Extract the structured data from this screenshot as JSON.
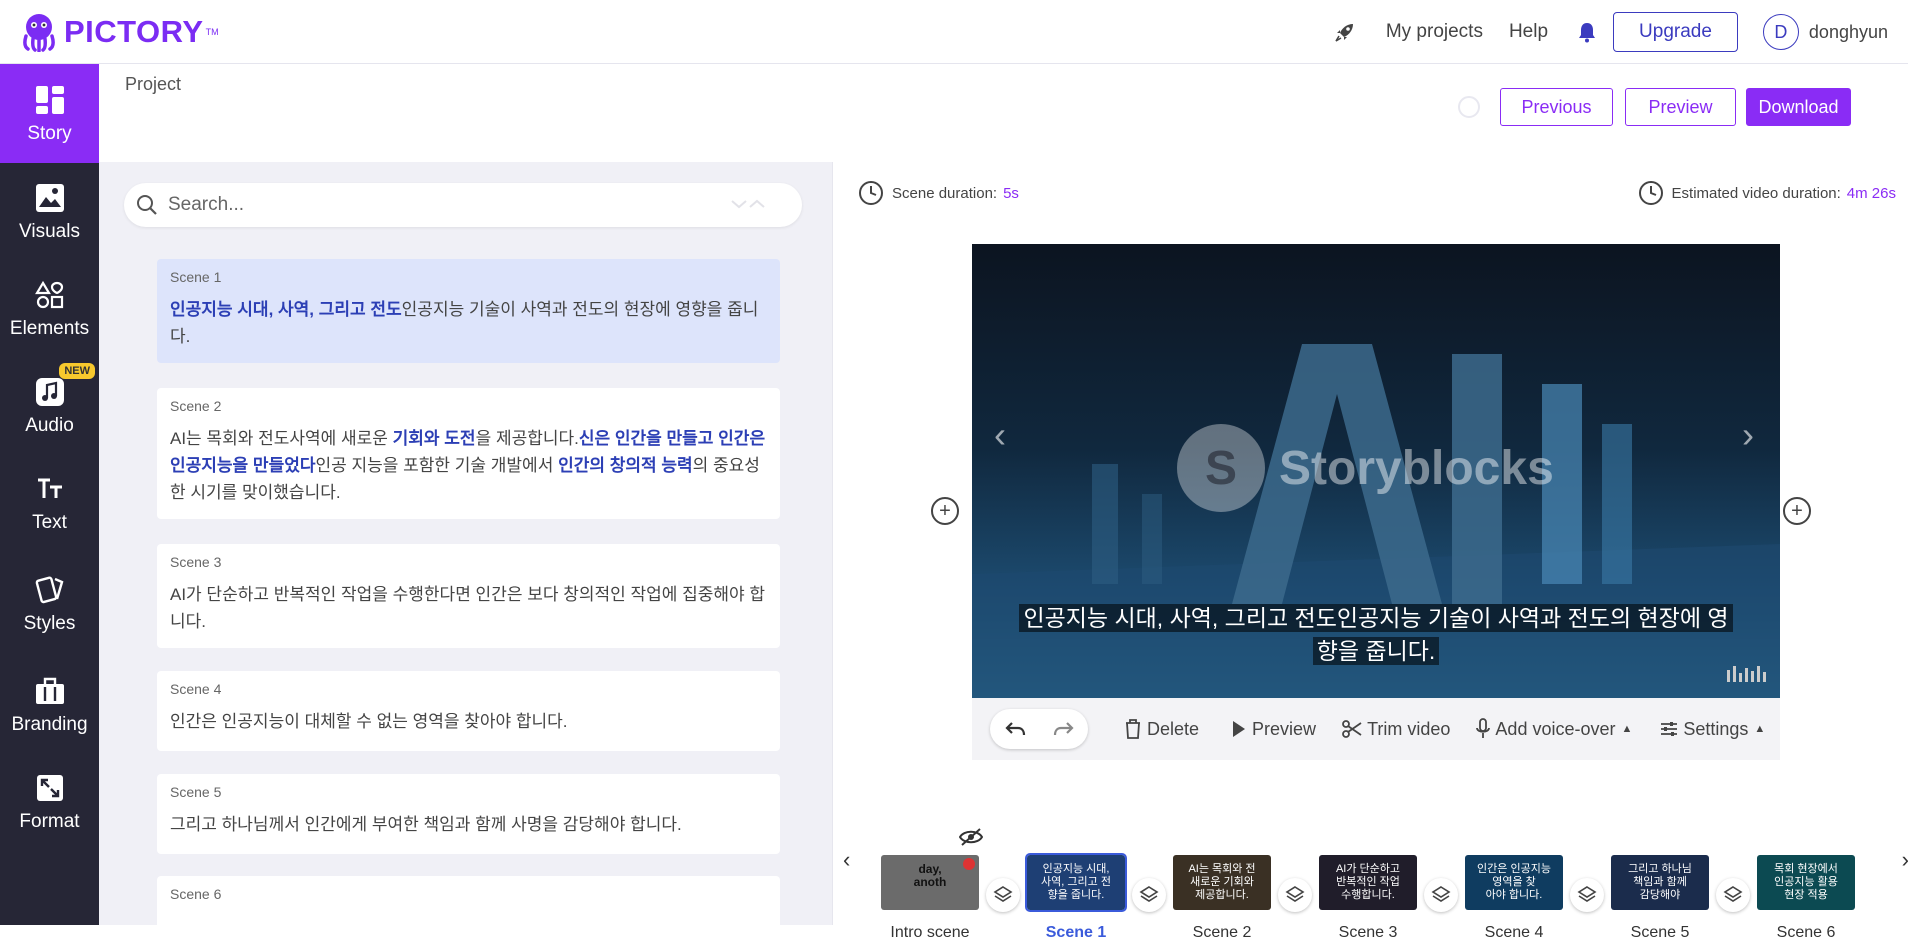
{
  "topbar": {
    "logo_text": "PICTORY",
    "logo_tm": "TM",
    "my_projects": "My projects",
    "help": "Help",
    "upgrade": "Upgrade",
    "avatar_initial": "D",
    "username": "donghyun"
  },
  "sidebar": {
    "items": [
      {
        "label": "Story",
        "icon": "story-icon"
      },
      {
        "label": "Visuals",
        "icon": "image-icon"
      },
      {
        "label": "Elements",
        "icon": "shapes-icon"
      },
      {
        "label": "Audio",
        "icon": "music-icon",
        "badge": "NEW"
      },
      {
        "label": "Text",
        "icon": "text-icon"
      },
      {
        "label": "Styles",
        "icon": "styles-icon"
      },
      {
        "label": "Branding",
        "icon": "briefcase-icon"
      },
      {
        "label": "Format",
        "icon": "format-icon"
      }
    ]
  },
  "header": {
    "project_label": "Project",
    "previous": "Previous",
    "preview": "Preview",
    "download": "Download"
  },
  "search": {
    "placeholder": "Search..."
  },
  "scenes": [
    {
      "title": "Scene 1",
      "parts": [
        {
          "t": "인공지능 시대, 사역, 그리고 전도",
          "h": true
        },
        {
          "t": "인공지능 기술이 사역과 전도의 현장에 영향을 줍니다.",
          "h": false
        }
      ]
    },
    {
      "title": "Scene 2",
      "parts": [
        {
          "t": "AI는 목회와 전도사역에 새로운 ",
          "h": false
        },
        {
          "t": "기회와 도전",
          "h": true
        },
        {
          "t": "을 제공합니다.",
          "h": false
        },
        {
          "t": "신은 인간을 만들고 인간은 인공지능을 만들었다",
          "h": true
        },
        {
          "t": "인공 지능을 포함한 기술 개발에서 ",
          "h": false
        },
        {
          "t": "인간의 창의적 능력",
          "h": true
        },
        {
          "t": "의 중요성한 시기를 맞이했습니다.",
          "h": false
        }
      ]
    },
    {
      "title": "Scene 3",
      "parts": [
        {
          "t": "AI가 단순하고 반복적인 작업을 수행한다면 인간은 보다 창의적인 작업에 집중해야 합니다.",
          "h": false
        }
      ]
    },
    {
      "title": "Scene 4",
      "parts": [
        {
          "t": "인간은 인공지능이 대체할 수 없는 영역을 찾아야 합니다.",
          "h": false
        }
      ]
    },
    {
      "title": "Scene 5",
      "parts": [
        {
          "t": "그리고 하나님께서 인간에게 부여한 책임과 함께 사명을 감당해야 합니다.",
          "h": false
        }
      ]
    },
    {
      "title": "Scene 6",
      "parts": [
        {
          "t": "",
          "h": false
        }
      ]
    }
  ],
  "editor": {
    "scene_duration_label": "Scene duration:",
    "scene_duration_value": "5s",
    "est_duration_label": "Estimated video duration:",
    "est_duration_value": "4m 26s",
    "watermark": "Storyblocks",
    "caption_line1": "인공지능 시대, 사역, 그리고 전도인공지능 기술이 사역과 전도의 현장에 영",
    "caption_line2": "향을 줍니다.",
    "controls": {
      "delete": "Delete",
      "preview": "Preview",
      "trim": "Trim video",
      "voice": "Add voice-over",
      "settings": "Settings"
    }
  },
  "timeline": {
    "thumbs": [
      {
        "label": "Intro scene",
        "text": "day,\nanoth",
        "bg": "#5a5a5a"
      },
      {
        "label": "Scene 1",
        "text": "인공지능 시대,\n사역, 그리고 전\n향을 줍니다.",
        "bg": "#1e3f74"
      },
      {
        "label": "Scene 2",
        "text": "AI는 목회와 전\n새로운 기회와\n제공합니다.",
        "bg": "#3a3024"
      },
      {
        "label": "Scene 3",
        "text": "AI가 단순하고\n반복적인 작업\n수행합니다.",
        "bg": "#201d2a"
      },
      {
        "label": "Scene 4",
        "text": "인간은 인공지능\n영역을 찾\n아야 합니다.",
        "bg": "#0f3c60"
      },
      {
        "label": "Scene 5",
        "text": "그리고 하나님\n책임과 함께\n감당해야",
        "bg": "#1b2c4c"
      },
      {
        "label": "Scene 6",
        "text": "목회 현장에서\n인공지능 활용\n현장 적용",
        "bg": "#0c4a52"
      }
    ]
  }
}
